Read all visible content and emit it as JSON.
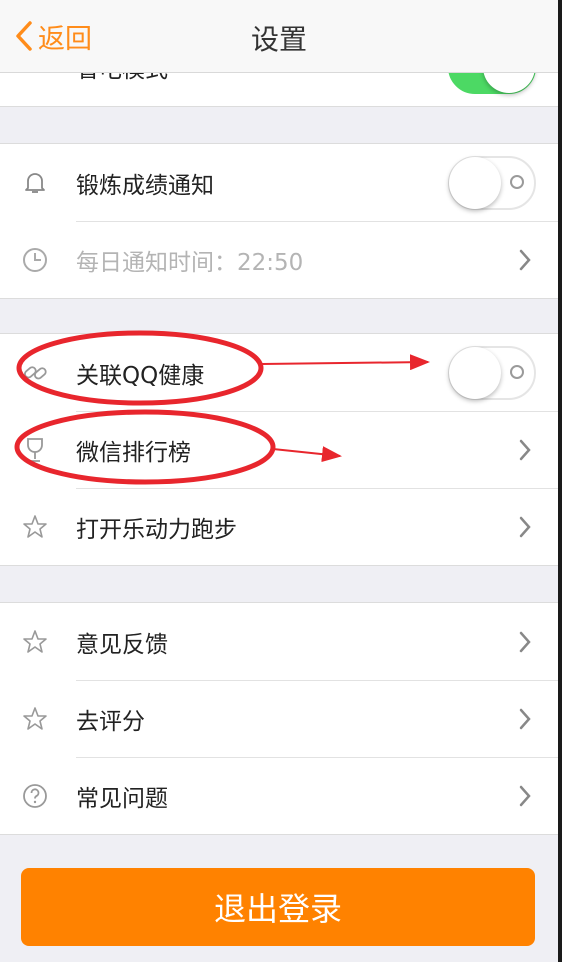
{
  "nav": {
    "back_label": "返回",
    "title": "设置"
  },
  "top_row": {
    "label": "省电模式",
    "toggle_on": true
  },
  "group1": {
    "items": [
      {
        "label": "锻炼成绩通知",
        "control": "toggle",
        "toggle_on": false,
        "icon": "bell-icon"
      },
      {
        "label": "每日通知时间：22:50",
        "control": "chevron",
        "disabled": true,
        "icon": "clock-icon"
      }
    ]
  },
  "group2": {
    "items": [
      {
        "label": "关联QQ健康",
        "control": "toggle",
        "toggle_on": false,
        "icon": "link-icon"
      },
      {
        "label": "微信排行榜",
        "control": "chevron",
        "icon": "trophy-icon"
      },
      {
        "label": "打开乐动力跑步",
        "control": "chevron",
        "icon": "star-icon"
      }
    ]
  },
  "group3": {
    "items": [
      {
        "label": "意见反馈",
        "control": "chevron",
        "icon": "star-icon"
      },
      {
        "label": "去评分",
        "control": "chevron",
        "icon": "star-icon"
      },
      {
        "label": "常见问题",
        "control": "chevron",
        "icon": "question-icon"
      }
    ]
  },
  "logout": {
    "label": "退出登录"
  },
  "colors": {
    "accent": "#ff8200",
    "toggle_on": "#4cd964",
    "annotation": "#e8262d"
  }
}
